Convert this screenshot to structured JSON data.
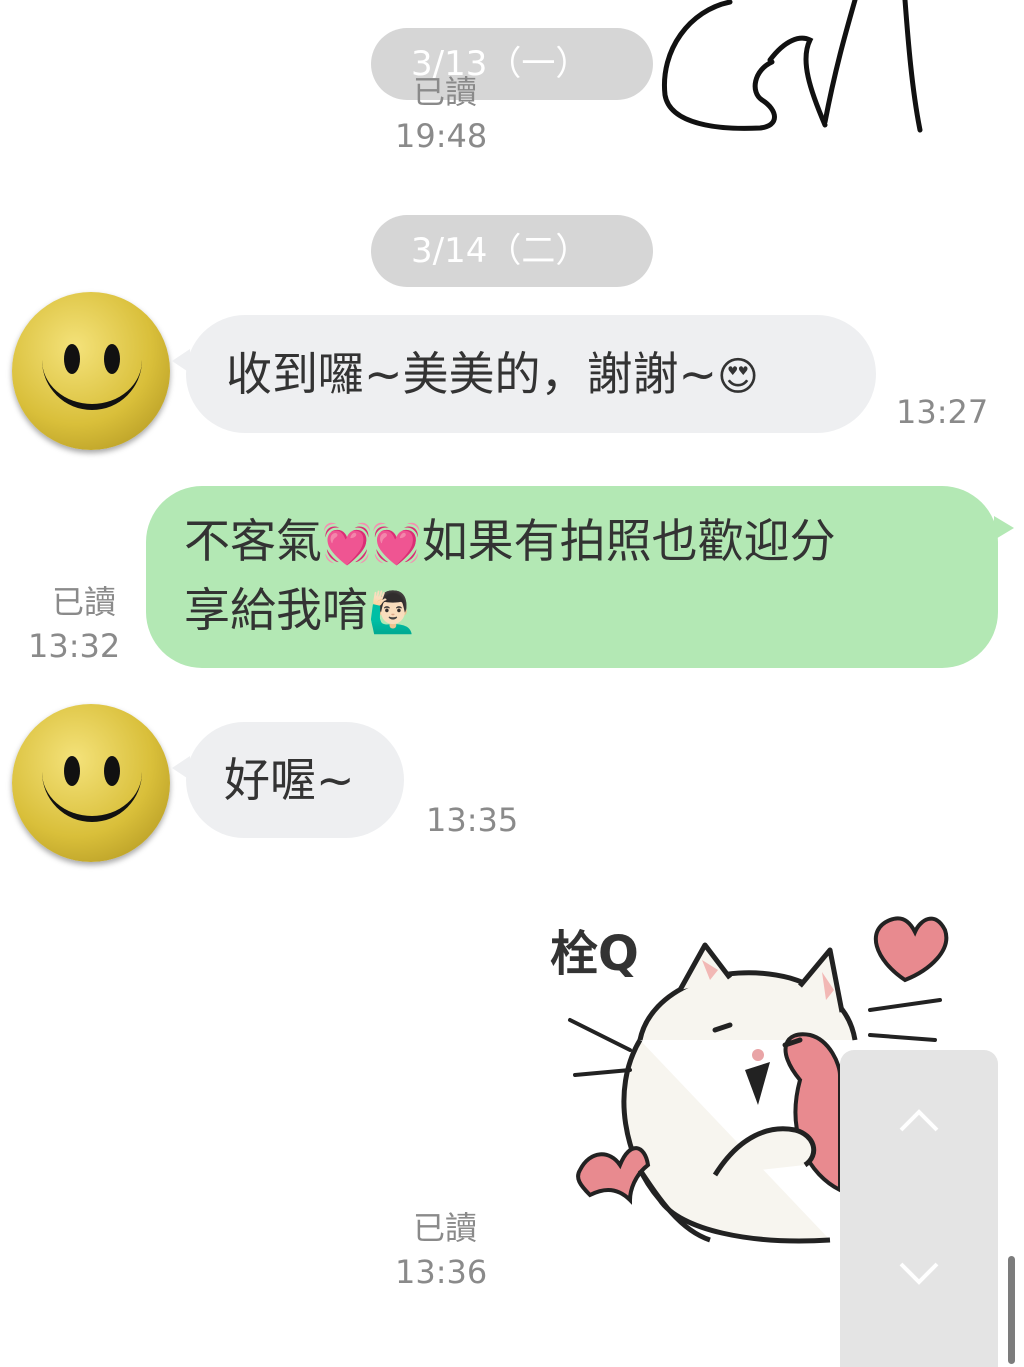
{
  "dates": {
    "d1": "3/13（一）",
    "d2": "3/14（二）"
  },
  "messages": {
    "m0": {
      "read": "已讀",
      "time": "19:48"
    },
    "m1": {
      "text": "收到囉~美美的，謝謝~",
      "emoji": "😍",
      "time": "13:27"
    },
    "m2": {
      "line1": "不客氣",
      "heart1": "💓",
      "heart2": "💓",
      "line1b": "如果有拍照也歡迎分",
      "line2": "享給我唷",
      "emoji": "🙋🏻‍♂️",
      "read": "已讀",
      "time": "13:32"
    },
    "m3": {
      "text": "好喔~",
      "time": "13:35"
    },
    "m4": {
      "sticker_text": "栓Q",
      "read": "已讀",
      "time": "13:36"
    }
  },
  "icons": {
    "avatar": "smiley-face-avatar",
    "up": "chevron-up-icon",
    "down": "chevron-down-icon",
    "sticker": "white-cat-heart-sticker"
  },
  "colors": {
    "outgoing": "#b3e8b4",
    "incoming": "#eeeff1",
    "date_pill": "#d6d6d6"
  }
}
